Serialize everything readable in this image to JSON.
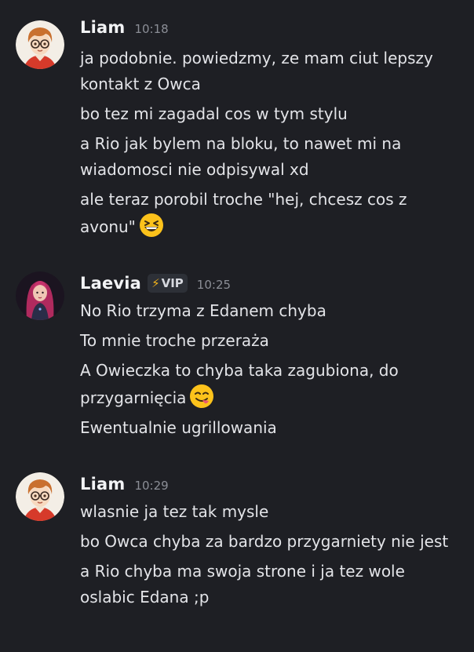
{
  "groups": [
    {
      "author": "Liam",
      "time": "10:18",
      "avatar": "cartoon-boy-glasses",
      "messages": [
        "ja podobnie. powiedzmy, ze mam ciut lepszy kontakt z Owca",
        "bo tez mi zagadal cos w tym stylu",
        "a Rio jak bylem na bloku, to nawet mi na wiadomosci nie odpisywal xd",
        "ale teraz porobil troche \"hej, chcesz cos z avonu\""
      ],
      "emoji": "grinning-squinting-face"
    },
    {
      "author": "Laevia",
      "time": "10:25",
      "avatar": "woman-red-hair",
      "badge": {
        "icon": "lightning-bolt-icon",
        "label": "VIP",
        "icon_color": "#f5b51c"
      },
      "messages": [
        "No Rio trzyma z Edanem chyba",
        "To mnie troche przeraża",
        "A Owieczka to chyba taka zagubiona, do przygarnięcia",
        "Ewentualnie ugrillowania"
      ],
      "emoji": "face-savoring-food"
    },
    {
      "author": "Liam",
      "time": "10:29",
      "avatar": "cartoon-boy-glasses",
      "messages": [
        "wlasnie ja tez tak mysle",
        "bo Owca chyba za bardzo przygarniety nie jest",
        "a Rio chyba ma swoja strone i ja tez wole oslabic Edana ;p"
      ]
    }
  ],
  "colors": {
    "background": "#1e1f24",
    "text": "#e3e4e8",
    "username": "#f2f3f5",
    "timestamp": "#8b8e96"
  }
}
